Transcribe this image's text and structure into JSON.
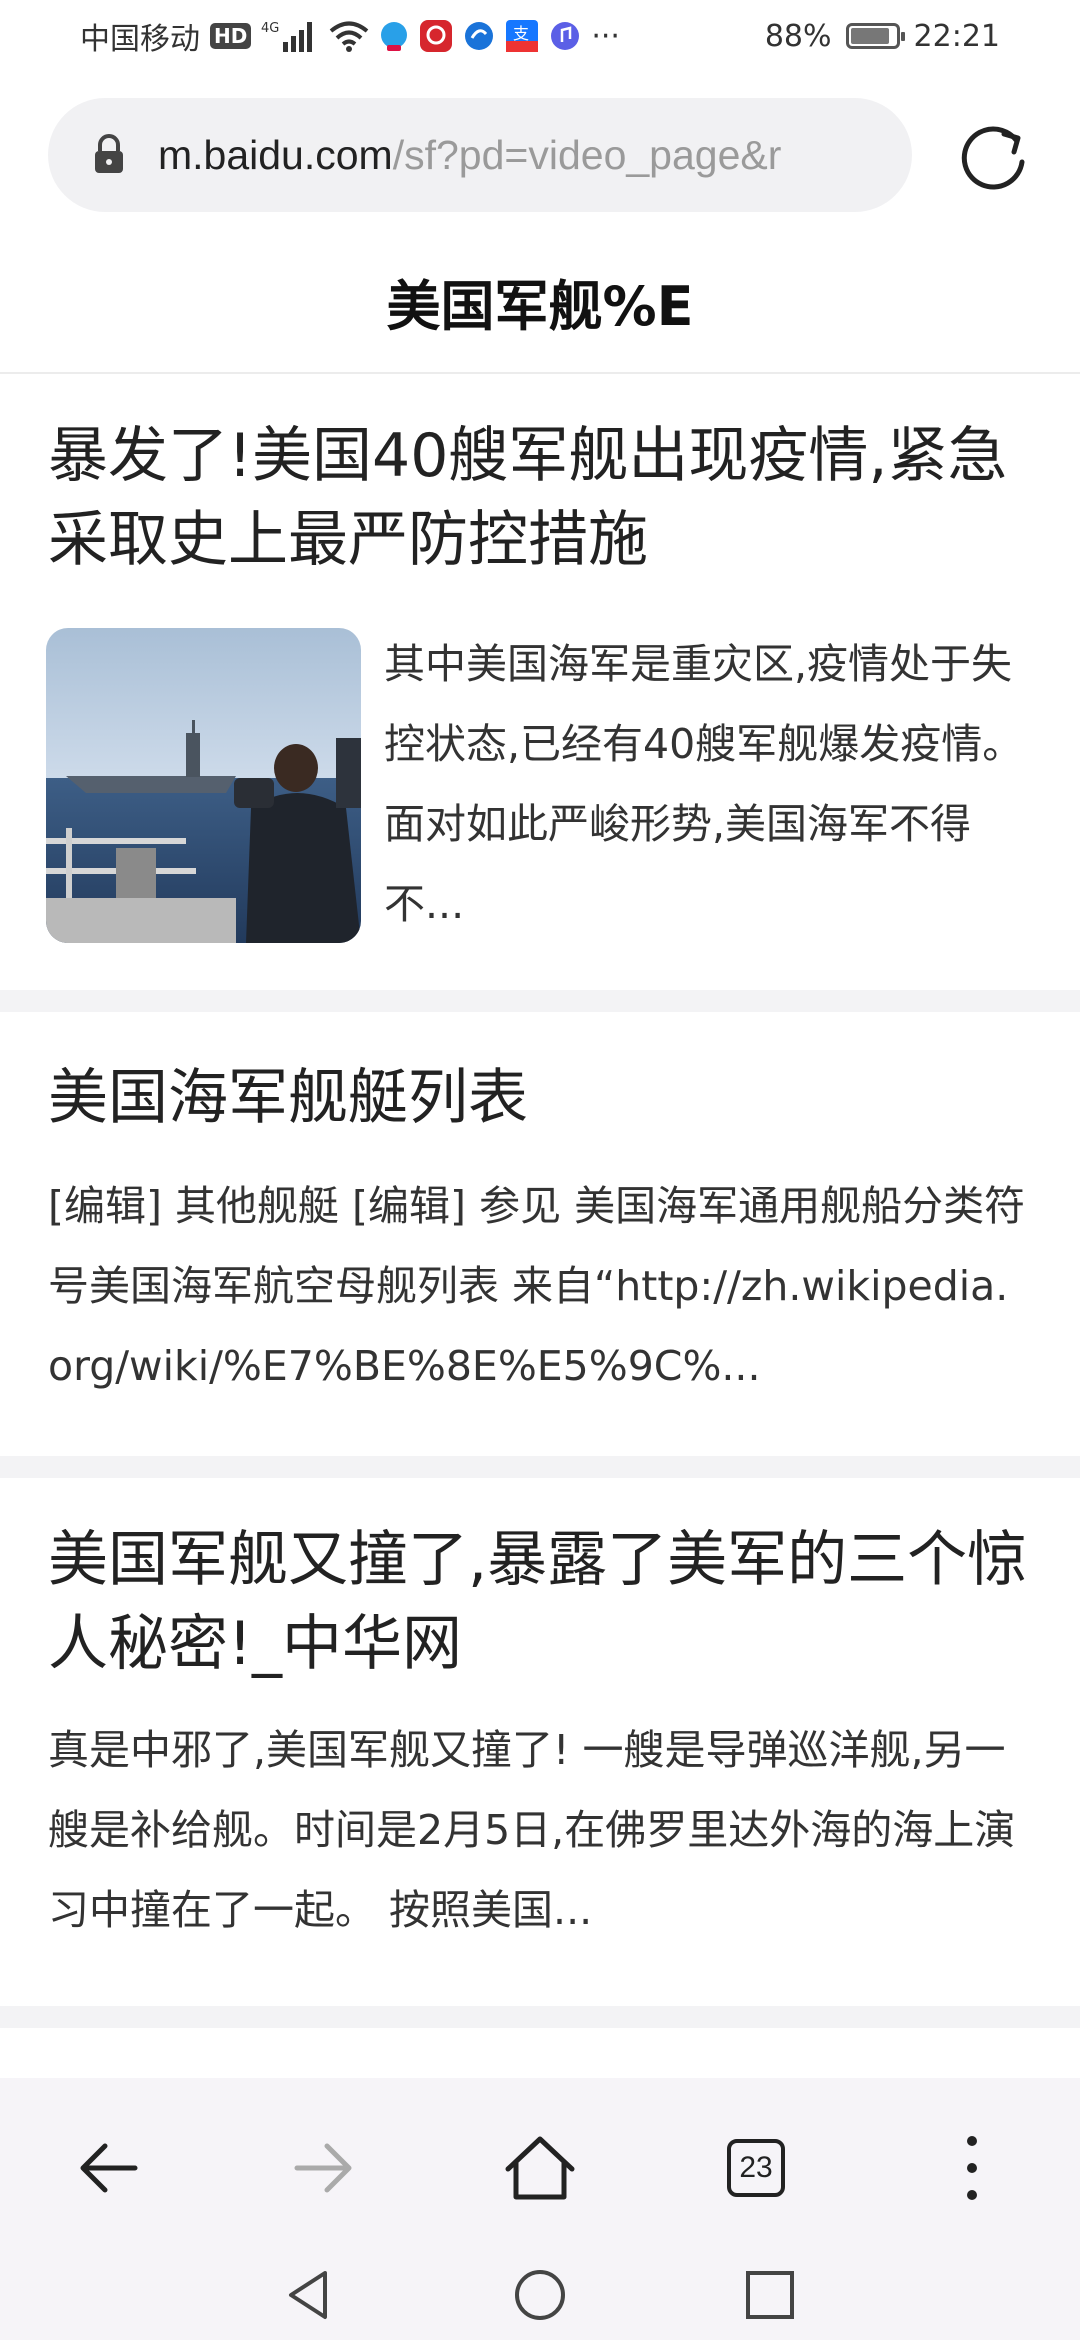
{
  "status_bar": {
    "carrier": "中国移动",
    "hd": "HD",
    "network": "4G",
    "more": "···",
    "battery": "88%",
    "battery_level": 0.88,
    "time": "22:21",
    "app_icons": [
      "weibo-style-app-icon",
      "red-app-icon",
      "blue-app-icon",
      "alipay-app-icon",
      "music-app-icon"
    ]
  },
  "address_bar": {
    "domain": "m.baidu.com",
    "path": "/sf?pd=video_page&r"
  },
  "page": {
    "title": "美国军舰%E"
  },
  "results": [
    {
      "title": "暴发了!美国40艘军舰出现疫情,紧急采取史上最严防控措施",
      "snippet": "其中美国海军是重灾区,疫情处于失控状态,已经有40艘军舰爆发疫情。面对如此严峻形势,美国海军不得不..."
    },
    {
      "title": "美国海军舰艇列表",
      "snippet": "[编辑] 其他舰艇 [编辑] 参见 美国海军通用舰船分类符号美国海军航空母舰列表 来自“http://zh.wikipedia.org/wiki/%E7%BE%8E%E5%9C%..."
    },
    {
      "title": "美国军舰又撞了,暴露了美军的三个惊人秘密!_中华网",
      "snippet": "真是中邪了,美国军舰又撞了! 一艘是导弹巡洋舰,另一艘是补给舰。时间是2月5日,在佛罗里达外海的海上演习中撞在了一起。 按照美国..."
    }
  ],
  "bottom_nav": {
    "tab_count": "23"
  },
  "colors": {
    "accent_text": "#222222",
    "url_muted": "#9a9a9a",
    "separator": "#f3f3f5",
    "nav_background": "#f6f4f8"
  }
}
